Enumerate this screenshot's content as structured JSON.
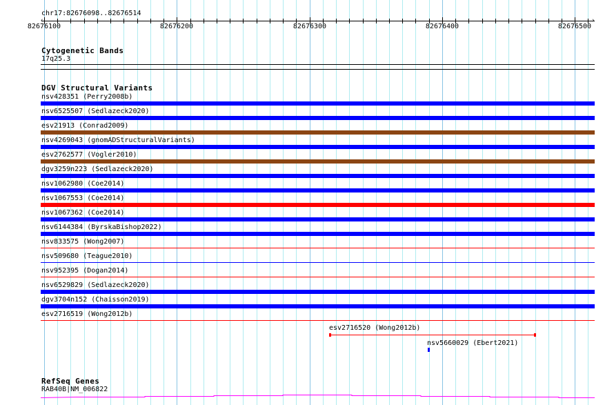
{
  "location": "chr17:82676098..82676514",
  "view": {
    "start": 82676098,
    "end": 82676514
  },
  "ruler": {
    "labels": [
      "82676100",
      "82676200",
      "82676300",
      "82676400",
      "82676500"
    ],
    "minor_tick_bp": 10,
    "major_tick_bp": 100
  },
  "cytoband_track": {
    "title": "Cytogenetic Bands",
    "band": "17q25.3"
  },
  "dgv_track": {
    "title": "DGV Structural Variants",
    "rows": [
      {
        "label": "nsv428351 (Perry2008b)",
        "color": "#0000ff",
        "style": "thick"
      },
      {
        "label": "nsv6525507 (Sedlazeck2020)",
        "color": "#0000ff",
        "style": "thick"
      },
      {
        "label": "esv21913 (Conrad2009)",
        "color": "#8b4513",
        "style": "thick"
      },
      {
        "label": "nsv4269043 (gnomADStructuralVariants)",
        "color": "#0000ff",
        "style": "thick"
      },
      {
        "label": "esv2762577 (Vogler2010)",
        "color": "#8b4513",
        "style": "thick"
      },
      {
        "label": "dgv3259n223 (Sedlazeck2020)",
        "color": "#0000ff",
        "style": "thick"
      },
      {
        "label": "nsv1062980 (Coe2014)",
        "color": "#0000ff",
        "style": "thick"
      },
      {
        "label": "nsv1067553 (Coe2014)",
        "color": "#ff0000",
        "style": "thick"
      },
      {
        "label": "nsv1067362 (Coe2014)",
        "color": "#0000ff",
        "style": "thick"
      },
      {
        "label": "nsv6144384 (ByrskaBishop2022)",
        "color": "#0000ff",
        "style": "thick"
      },
      {
        "label": "nsv833575 (Wong2007)",
        "color": "#ff0000",
        "style": "thin"
      },
      {
        "label": "nsv509680 (Teague2010)",
        "color": "#0000ff",
        "style": "thin"
      },
      {
        "label": "nsv952395 (Dogan2014)",
        "color": "#ff0000",
        "style": "thin"
      },
      {
        "label": "nsv6529829 (Sedlazeck2020)",
        "color": "#0000ff",
        "style": "thick"
      },
      {
        "label": "dgv3704n152 (Chaisson2019)",
        "color": "#0000ff",
        "style": "thick"
      },
      {
        "label": "esv2716519 (Wong2012b)",
        "color": "#ff0000",
        "style": "thin"
      }
    ],
    "extra": [
      {
        "label": "esv2716520 (Wong2012b)",
        "color": "#ff0000",
        "start": 82676315,
        "end": 82676470
      },
      {
        "label": "nsv5660029 (Ebert2021)",
        "color": "#0000ff",
        "start": 82676389,
        "end": 82676390
      }
    ]
  },
  "refseq_track": {
    "title": "RefSeq Genes",
    "gene": "RAB40B|NM_006822",
    "color": "#ff00ff"
  }
}
